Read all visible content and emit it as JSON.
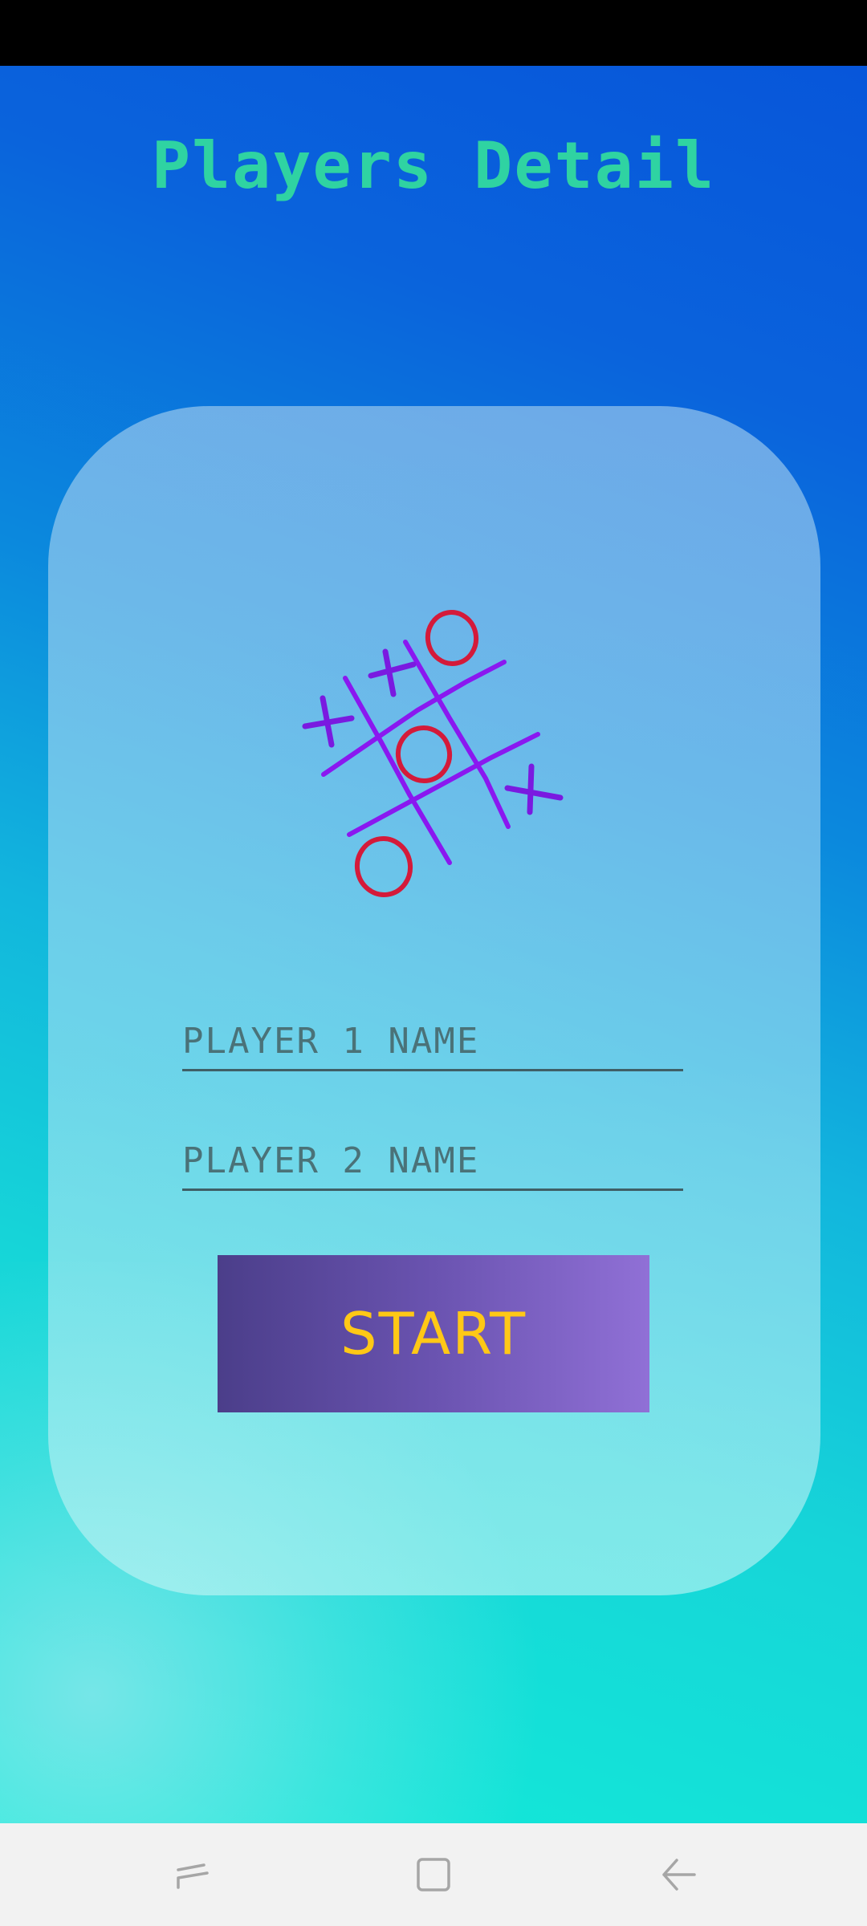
{
  "screen": {
    "title": "Players Detail"
  },
  "form": {
    "player1": {
      "placeholder": "PLAYER 1 NAME",
      "value": ""
    },
    "player2": {
      "placeholder": "PLAYER 2 NAME",
      "value": ""
    },
    "start_label": "START"
  },
  "icons": {
    "logo": "tic-tac-toe-board-icon",
    "nav_recent": "recent-apps-icon",
    "nav_home": "home-icon",
    "nav_back": "back-icon"
  },
  "colors": {
    "title": "#2fd3a2",
    "start_text": "#ffc816",
    "grid_lines": "#8a18f0",
    "o_marks": "#d41a3a",
    "x_marks": "#7a1ae0"
  }
}
